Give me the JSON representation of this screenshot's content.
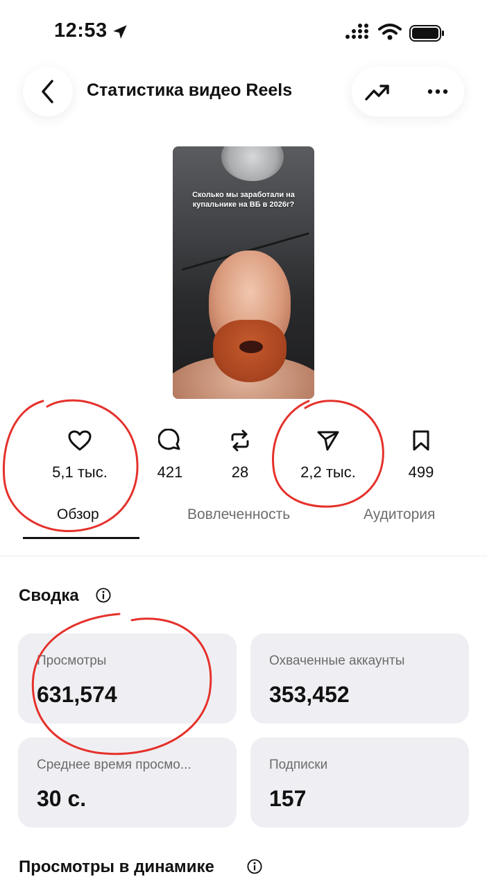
{
  "status_bar": {
    "time": "12:53"
  },
  "header": {
    "title": "Статистика видео Reels"
  },
  "thumbnail": {
    "caption": "Сколько мы заработали на купальнике на ВБ в 2026г?"
  },
  "stats": {
    "likes": "5,1 тыс.",
    "comments": "421",
    "reposts": "28",
    "shares": "2,2 тыс.",
    "saves": "499"
  },
  "tabs": {
    "overview": "Обзор",
    "engagement": "Вовлеченность",
    "audience": "Аудитория"
  },
  "summary": {
    "title": "Сводка",
    "cards": [
      {
        "label": "Просмотры",
        "value": "631,574"
      },
      {
        "label": "Охваченные аккаунты",
        "value": "353,452"
      },
      {
        "label": "Среднее время просмо...",
        "value": "30 с."
      },
      {
        "label": "Подписки",
        "value": "157"
      }
    ]
  },
  "dynamics": {
    "title": "Просмотры в динамике"
  },
  "colors": {
    "annotation": "#e5312b",
    "card_bg": "#efeff3"
  }
}
